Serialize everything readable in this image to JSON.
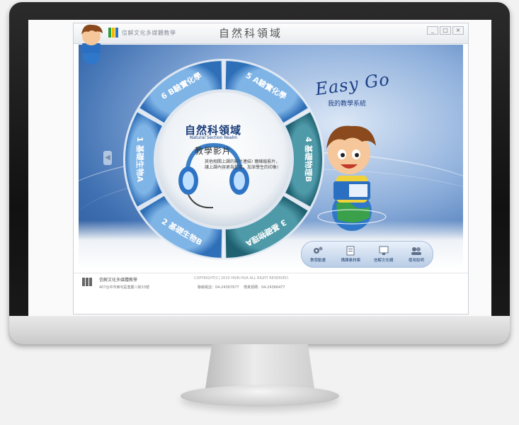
{
  "window": {
    "title": "自然科領域",
    "company": "信解文化多媒體教學",
    "buttons": [
      "_",
      "□",
      "×"
    ]
  },
  "realm": {
    "title": "自然科領域",
    "subtitle": "Natural Section Realm",
    "section_label": "教學影片",
    "description": "其他相關上課的影片連結! 爾峰級影片，讓上課內容更為豐富，加深學生的印象!"
  },
  "menu": [
    {
      "number": "1",
      "label": "基礎生物A"
    },
    {
      "number": "2",
      "label": "基礎生物B"
    },
    {
      "number": "3",
      "label": "基礎物理A"
    },
    {
      "number": "4",
      "label": "基礎物理B"
    },
    {
      "number": "5",
      "label": "A驗實化學"
    },
    {
      "number": "6",
      "label": "B驗實化學"
    }
  ],
  "branding": {
    "slogan": "Easy Go",
    "tagline": "我的教學系統"
  },
  "toolbar": [
    {
      "label": "教學動畫",
      "icon": "gears-icon"
    },
    {
      "label": "備課素材庫",
      "icon": "document-icon"
    },
    {
      "label": "信解文化網",
      "icon": "monitor-icon"
    },
    {
      "label": "使用說明",
      "icon": "users-icon"
    }
  ],
  "footer": {
    "company": "信解文化多媒體教學",
    "address": "407台中市西屯區重慶八街33號",
    "copyright": "COPYRIGHT(C) 2010 HSIN HUA ALL RIGHT RESERVED.",
    "phone": "聯絡電話：04-24367677",
    "fax": "傳真號碼：04-24366477"
  },
  "colors": {
    "ring_blue": "#3f82c8",
    "ring_teal": "#2f7d8f",
    "stage_blue": "#3e6fb1",
    "title_navy": "#1a3e7a"
  }
}
